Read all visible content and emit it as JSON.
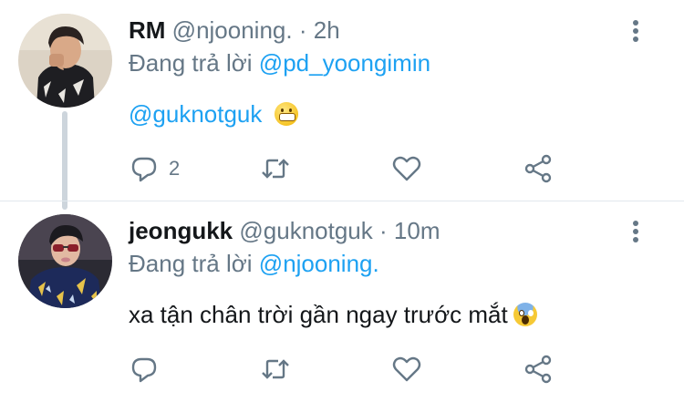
{
  "tweets": [
    {
      "name": "RM",
      "handle": "@njooning.",
      "separator": "·",
      "time": "2h",
      "reply_prefix": "Đang trả lời",
      "reply_to": "@pd_yoongimin",
      "mention": "@guknotguk",
      "text": "",
      "emoji": "grinning-face-emoji",
      "reply_count": "2"
    },
    {
      "name": "jeongukk",
      "handle": "@guknotguk",
      "separator": "·",
      "time": "10m",
      "reply_prefix": "Đang trả lời",
      "reply_to": "@njooning.",
      "mention": "",
      "text": "xa tận chân trời gần ngay trước mắt",
      "emoji": "screaming-face-emoji",
      "reply_count": ""
    }
  ],
  "colors": {
    "link": "#1da1f2",
    "muted": "#657786",
    "thread_line": "#cdd5dc"
  }
}
